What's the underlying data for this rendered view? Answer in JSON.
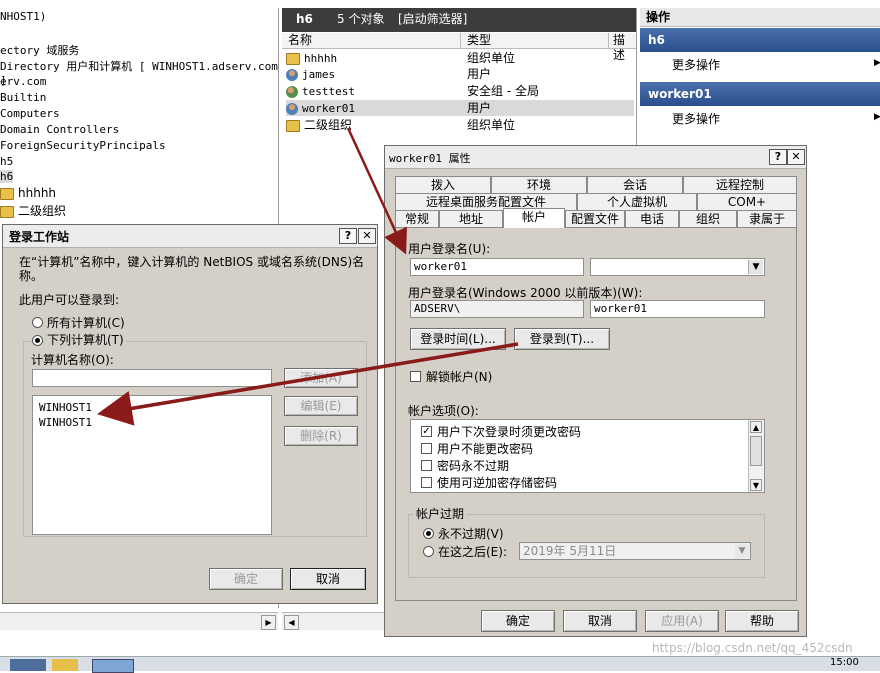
{
  "left_tree": {
    "items": [
      "NHOST1)",
      "ectory 域服务",
      "Directory 用户和计算机 [ WINHOST1.adserv.com ]",
      "erv.com",
      "Builtin",
      "Computers",
      "Domain Controllers",
      "ForeignSecurityPrincipals",
      "h5",
      "h6",
      "hhhhh",
      "二级组织"
    ]
  },
  "list_view": {
    "header": {
      "folder": "h6",
      "count": "5 个对象",
      "filter": "[启动筛选器]"
    },
    "columns": [
      "名称",
      "类型",
      "描述"
    ],
    "rows": [
      {
        "name": "hhhhh",
        "type": "组织单位",
        "icon": "ou-icon"
      },
      {
        "name": "james",
        "type": "用户",
        "icon": "user-icon"
      },
      {
        "name": "testtest",
        "type": "安全组 - 全局",
        "icon": "group-icon"
      },
      {
        "name": "worker01",
        "type": "用户",
        "icon": "user-icon"
      },
      {
        "name": "二级组织",
        "type": "组织单位",
        "icon": "ou-icon"
      }
    ]
  },
  "actions": {
    "title": "操作",
    "section1": "h6",
    "section1_item": "更多操作",
    "section2": "worker01",
    "section2_item": "更多操作"
  },
  "props": {
    "title": "worker01 属性",
    "help_btn": "?",
    "close_btn": "✕",
    "tabs_row1": [
      "拨入",
      "环境",
      "会话",
      "远程控制"
    ],
    "tabs_row2": [
      "远程桌面服务配置文件",
      "个人虚拟机",
      "COM+"
    ],
    "tabs_row3": [
      "常规",
      "地址",
      "帐户",
      "配置文件",
      "电话",
      "组织",
      "隶属于"
    ],
    "logon_name_label": "用户登录名(U):",
    "logon_name": "worker01",
    "pre2000_label": "用户登录名(Windows 2000 以前版本)(W):",
    "domain": "ADSERV\\",
    "pre2000_name": "worker01",
    "logon_hours_btn": "登录时间(L)...",
    "logon_to_btn": "登录到(T)...",
    "unlock_label": "解锁帐户(N)",
    "options_label": "帐户选项(O):",
    "options": [
      {
        "label": "用户下次登录时须更改密码",
        "checked": true
      },
      {
        "label": "用户不能更改密码",
        "checked": false
      },
      {
        "label": "密码永不过期",
        "checked": false
      },
      {
        "label": "使用可逆加密存储密码",
        "checked": false
      }
    ],
    "expire_group": "帐户过期",
    "never_label": "永不过期(V)",
    "after_label": "在这之后(E):",
    "after_date": "2019年  5月11日",
    "ok": "确定",
    "cancel": "取消",
    "apply": "应用(A)",
    "help": "帮助"
  },
  "logon_ws": {
    "title": "登录工作站",
    "help_btn": "?",
    "close_btn": "✕",
    "intro": "在“计算机”名称中，键入计算机的 NetBIOS 或域名系统(DNS)名称。",
    "can_logon_label": "此用户可以登录到:",
    "all_computers": "所有计算机(C)",
    "following_computers": "下列计算机(T)",
    "computer_name_label": "计算机名称(O):",
    "add_btn": "添加(A)",
    "edit_btn": "编辑(E)",
    "remove_btn": "删除(R)",
    "computers": [
      "WINHOST1",
      "WINHOST1"
    ],
    "ok": "确定",
    "cancel": "取消"
  },
  "watermark": "https://blog.csdn.net/qq_452csdn",
  "taskbar_time": "15:00",
  "colors": {
    "arrow": "#8b1a1a",
    "action_header": "#2a4f8c",
    "selection": "#d9d9d9"
  }
}
